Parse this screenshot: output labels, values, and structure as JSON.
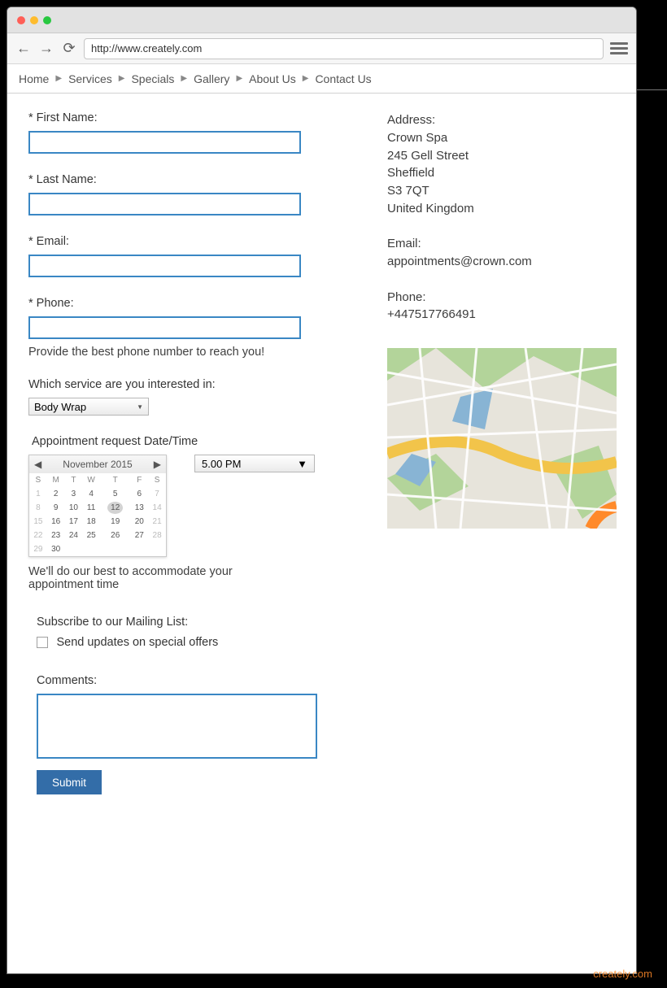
{
  "browser": {
    "url": "http://www.creately.com"
  },
  "nav": [
    "Home",
    "Services",
    "Specials",
    "Gallery",
    "About Us",
    "Contact Us"
  ],
  "form": {
    "first_name_label": "* First Name:",
    "last_name_label": "* Last Name:",
    "email_label": "* Email:",
    "phone_label": "* Phone:",
    "phone_hint": "Provide the best phone number to reach you!",
    "service_label": "Which service are you interested in:",
    "service_value": "Body Wrap",
    "appt_label": "Appointment request Date/Time",
    "time_value": "5.00 PM",
    "appt_hint": "We'll do our best to accommodate your appointment time",
    "subscribe_label": "Subscribe to our Mailing List:",
    "subscribe_option": "Send updates on special offers",
    "comments_label": "Comments:",
    "submit_label": "Submit"
  },
  "calendar": {
    "month": "November 2015",
    "dow": [
      "S",
      "M",
      "T",
      "W",
      "T",
      "F",
      "S"
    ],
    "weeks": [
      [
        {
          "d": 1,
          "o": true
        },
        {
          "d": 2
        },
        {
          "d": 3
        },
        {
          "d": 4
        },
        {
          "d": 5
        },
        {
          "d": 6
        },
        {
          "d": 7,
          "o": true
        }
      ],
      [
        {
          "d": 8,
          "o": true
        },
        {
          "d": 9
        },
        {
          "d": 10
        },
        {
          "d": 11
        },
        {
          "d": 12,
          "sel": true
        },
        {
          "d": 13
        },
        {
          "d": 14,
          "o": true
        }
      ],
      [
        {
          "d": 15,
          "o": true
        },
        {
          "d": 16
        },
        {
          "d": 17
        },
        {
          "d": 18
        },
        {
          "d": 19
        },
        {
          "d": 20
        },
        {
          "d": 21,
          "o": true
        }
      ],
      [
        {
          "d": 22,
          "o": true
        },
        {
          "d": 23
        },
        {
          "d": 24
        },
        {
          "d": 25
        },
        {
          "d": 26
        },
        {
          "d": 27
        },
        {
          "d": 28,
          "o": true
        }
      ],
      [
        {
          "d": 29,
          "o": true
        },
        {
          "d": 30
        },
        {
          "d": "",
          "o": true
        },
        {
          "d": "",
          "o": true
        },
        {
          "d": "",
          "o": true
        },
        {
          "d": "",
          "o": true
        },
        {
          "d": "",
          "o": true
        }
      ]
    ]
  },
  "info": {
    "address_label": "Address:",
    "lines": [
      "Crown Spa",
      "245 Gell Street",
      "Sheffield",
      "S3 7QT",
      "United Kingdom"
    ],
    "email_label": "Email:",
    "email": "appointments@crown.com",
    "phone_label": "Phone:",
    "phone": "+447517766491"
  },
  "watermark": "creately.com"
}
